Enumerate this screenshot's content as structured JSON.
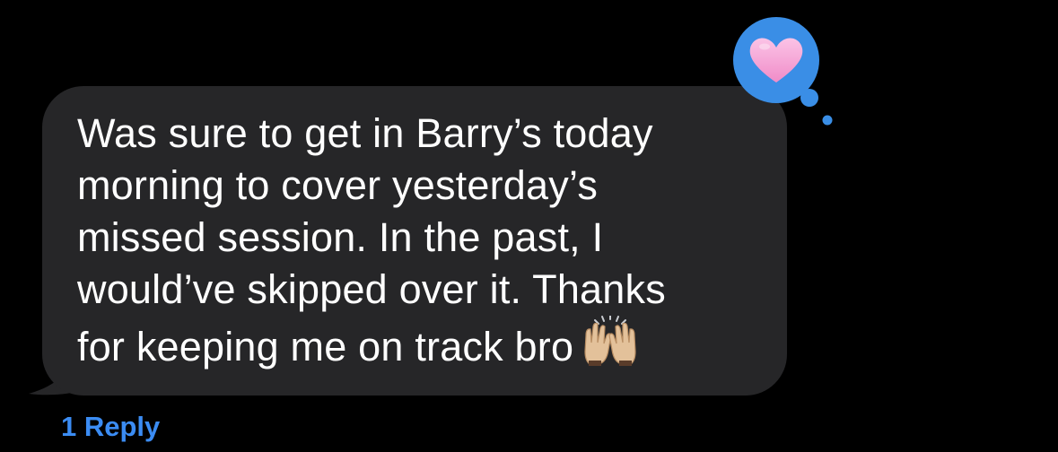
{
  "message": {
    "lines": [
      "Was sure to get in Barry’s today",
      "morning to cover yesterday’s",
      "missed session. In the past, I",
      "would’ve skipped over it. Thanks",
      "for keeping me on track bro"
    ],
    "emoji": "raising-hands-icon",
    "bubble_color": "#262628",
    "text_color": "#ffffff"
  },
  "tapback": {
    "icon": "heart-icon",
    "bubble_color": "#3a8ee6",
    "heart_color": "#f6a9d6"
  },
  "replies": {
    "label": "1 Reply",
    "color": "#3b8cf3"
  }
}
